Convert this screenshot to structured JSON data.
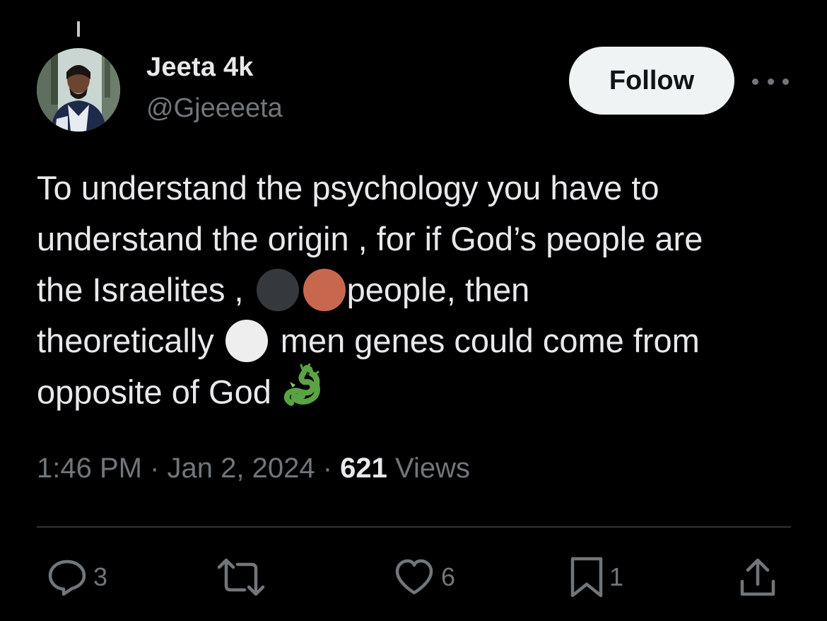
{
  "author": {
    "display_name": "Jeeta 4k",
    "handle": "@Gjeeeeta"
  },
  "header": {
    "follow_label": "Follow",
    "more_icon": "more-horizontal-icon"
  },
  "tweet": {
    "lines": [
      [
        "To understand the psychology you have to"
      ],
      [
        "understand the origin , for if God’s people are"
      ],
      [
        "the Israelites ,",
        "people, then"
      ],
      [
        "theoretically",
        "men genes could come from"
      ],
      [
        "opposite of God"
      ]
    ],
    "emojis": {
      "black_circle": "#35393d",
      "brown_circle": "#c7684e",
      "white_circle": "#eeeeee",
      "dragon": "dragon-emoji"
    }
  },
  "meta": {
    "time": "1:46 PM",
    "separator": " · ",
    "date": "Jan 2, 2024",
    "views_count": "621",
    "views_label": " Views"
  },
  "actions": {
    "replies": "3",
    "reposts": "",
    "likes": "6",
    "bookmarks": "1"
  },
  "colors": {
    "background": "#000000",
    "text": "#e7e9ea",
    "secondary": "#71767b",
    "divider": "#2f3336",
    "follow_bg": "#eff3f4"
  }
}
